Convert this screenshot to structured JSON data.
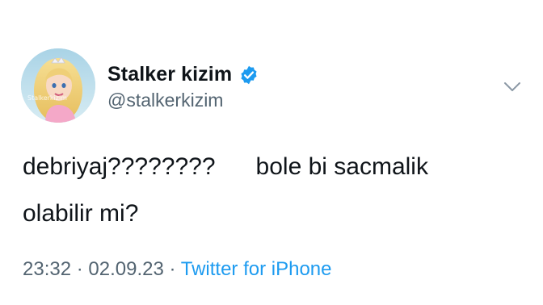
{
  "tweet": {
    "author": {
      "display_name": "Stalker kizim",
      "handle": "@stalkerkizim",
      "verified": true,
      "avatar_icon": "avatar-image",
      "avatar_watermark": "Stalkerkizim"
    },
    "text_lines": [
      "debriyaj????????      bole bi sacmalik",
      "olabilir mi?"
    ],
    "time": "23:32",
    "separator": "·",
    "date": "02.09.23",
    "source": "Twitter for iPhone",
    "menu_icon": "chevron-down-icon",
    "colors": {
      "text": "#0f1419",
      "secondary": "#536471",
      "accent": "#1d9bf0"
    }
  }
}
